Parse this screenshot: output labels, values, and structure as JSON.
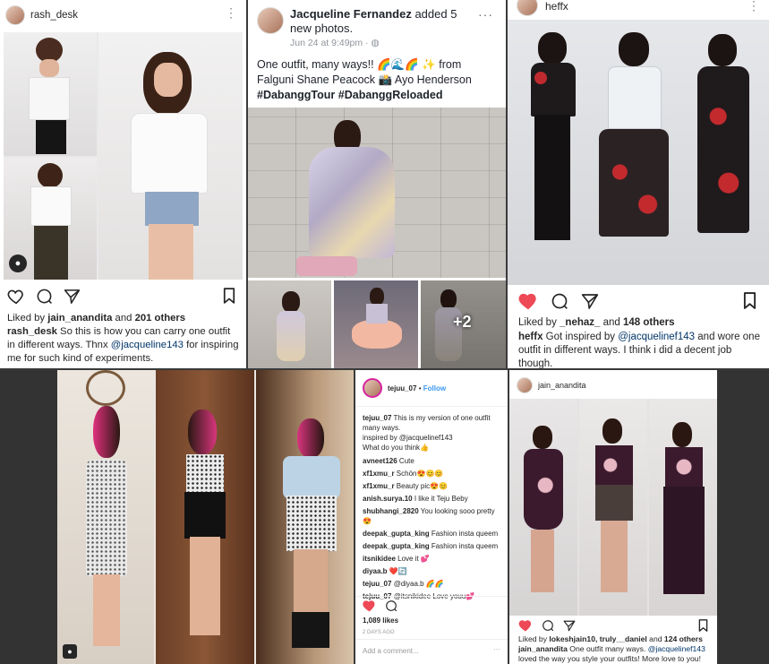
{
  "rash_desk": {
    "username": "rash_desk",
    "liked_prefix": "Liked by ",
    "liked_user": "jain_anandita",
    "liked_mid": " and ",
    "liked_count": "201 others",
    "caption_user": "rash_desk",
    "caption_text": " So this is how you can carry one outfit in different ways. Thnx ",
    "caption_mention": "@jacqueline143",
    "caption_rest": " for inspiring me for such kind of experiments."
  },
  "facebook": {
    "author": "Jacqueline Fernandez",
    "action": " added 5 new photos.",
    "timestamp": "Jun 24 at 9:49pm · ",
    "line1": "One outfit, many ways!! 🌈🌊🌈   ✨ from",
    "line2": "Falguni Shane Peacock 📸 Ayo Henderson",
    "hashtag1": "#DabanggTour",
    "hashtag2": "#DabanggReloaded",
    "more_count": "+2"
  },
  "heffx": {
    "username": "heffx",
    "liked_prefix": "Liked by ",
    "liked_user": "_nehaz_",
    "liked_mid": " and ",
    "liked_count": "148 others",
    "caption_user": "heffx",
    "caption_text": " Got inspired by ",
    "caption_mention": "@jacquelinef143",
    "caption_rest": " and wore one outfit in different ways. I think i did a decent job though."
  },
  "tejuu": {
    "username": "tejuu_07",
    "follow": "Follow",
    "separator": " • ",
    "comments": [
      {
        "user": "tejuu_07",
        "text": " This is my version of one outfit many ways."
      },
      {
        "user": "",
        "text": "inspired by @jacquelinef143"
      },
      {
        "user": "",
        "text": "What do you think👍"
      },
      {
        "user": "avneet126",
        "text": " Cute"
      },
      {
        "user": "xf1xmu_r",
        "text": " Schön😍😊😊"
      },
      {
        "user": "xf1xmu_r",
        "text": " Beauty pic😍😊"
      },
      {
        "user": "anish.surya.10",
        "text": " I like it Teju Beby"
      },
      {
        "user": "shubhangi_2820",
        "text": " You looking sooo pretty 😍"
      },
      {
        "user": "deepak_gupta_king",
        "text": " Fashion insta queem"
      },
      {
        "user": "deepak_gupta_king",
        "text": " Fashion insta queem"
      },
      {
        "user": "itsnikidee",
        "text": " Love it 💕"
      },
      {
        "user": "diyaa.b",
        "text": " ❤️🔄"
      },
      {
        "user": "tejuu_07",
        "text": " @diyaa.b 🌈🌈"
      },
      {
        "user": "tejuu_07",
        "text": " @itsnikidee Love youu💕"
      }
    ],
    "likes": "1,089 likes",
    "date": "2 DAYS AGO",
    "add_comment": "Add a comment...",
    "more": "···"
  },
  "jain": {
    "username": "jain_anandita",
    "liked_prefix": "Liked by ",
    "liked_users": "lokeshjain10, truly__daniel",
    "liked_mid": " and ",
    "liked_count": "124 others",
    "caption_user": "jain_anandita",
    "caption_text": " One outfit many ways. ",
    "caption_mention": "@jacquelinef143",
    "caption_rest": " loved the way you style your outfits! More love to you!"
  },
  "colors": {
    "heart_red": "#ed4956",
    "fb_blue": "#365899",
    "ig_blue": "#3897f0",
    "mention": "#003569"
  },
  "icons": [
    "more-icon",
    "heart-icon",
    "comment-icon",
    "share-icon",
    "bookmark-icon",
    "globe-icon",
    "user-tag-icon"
  ]
}
